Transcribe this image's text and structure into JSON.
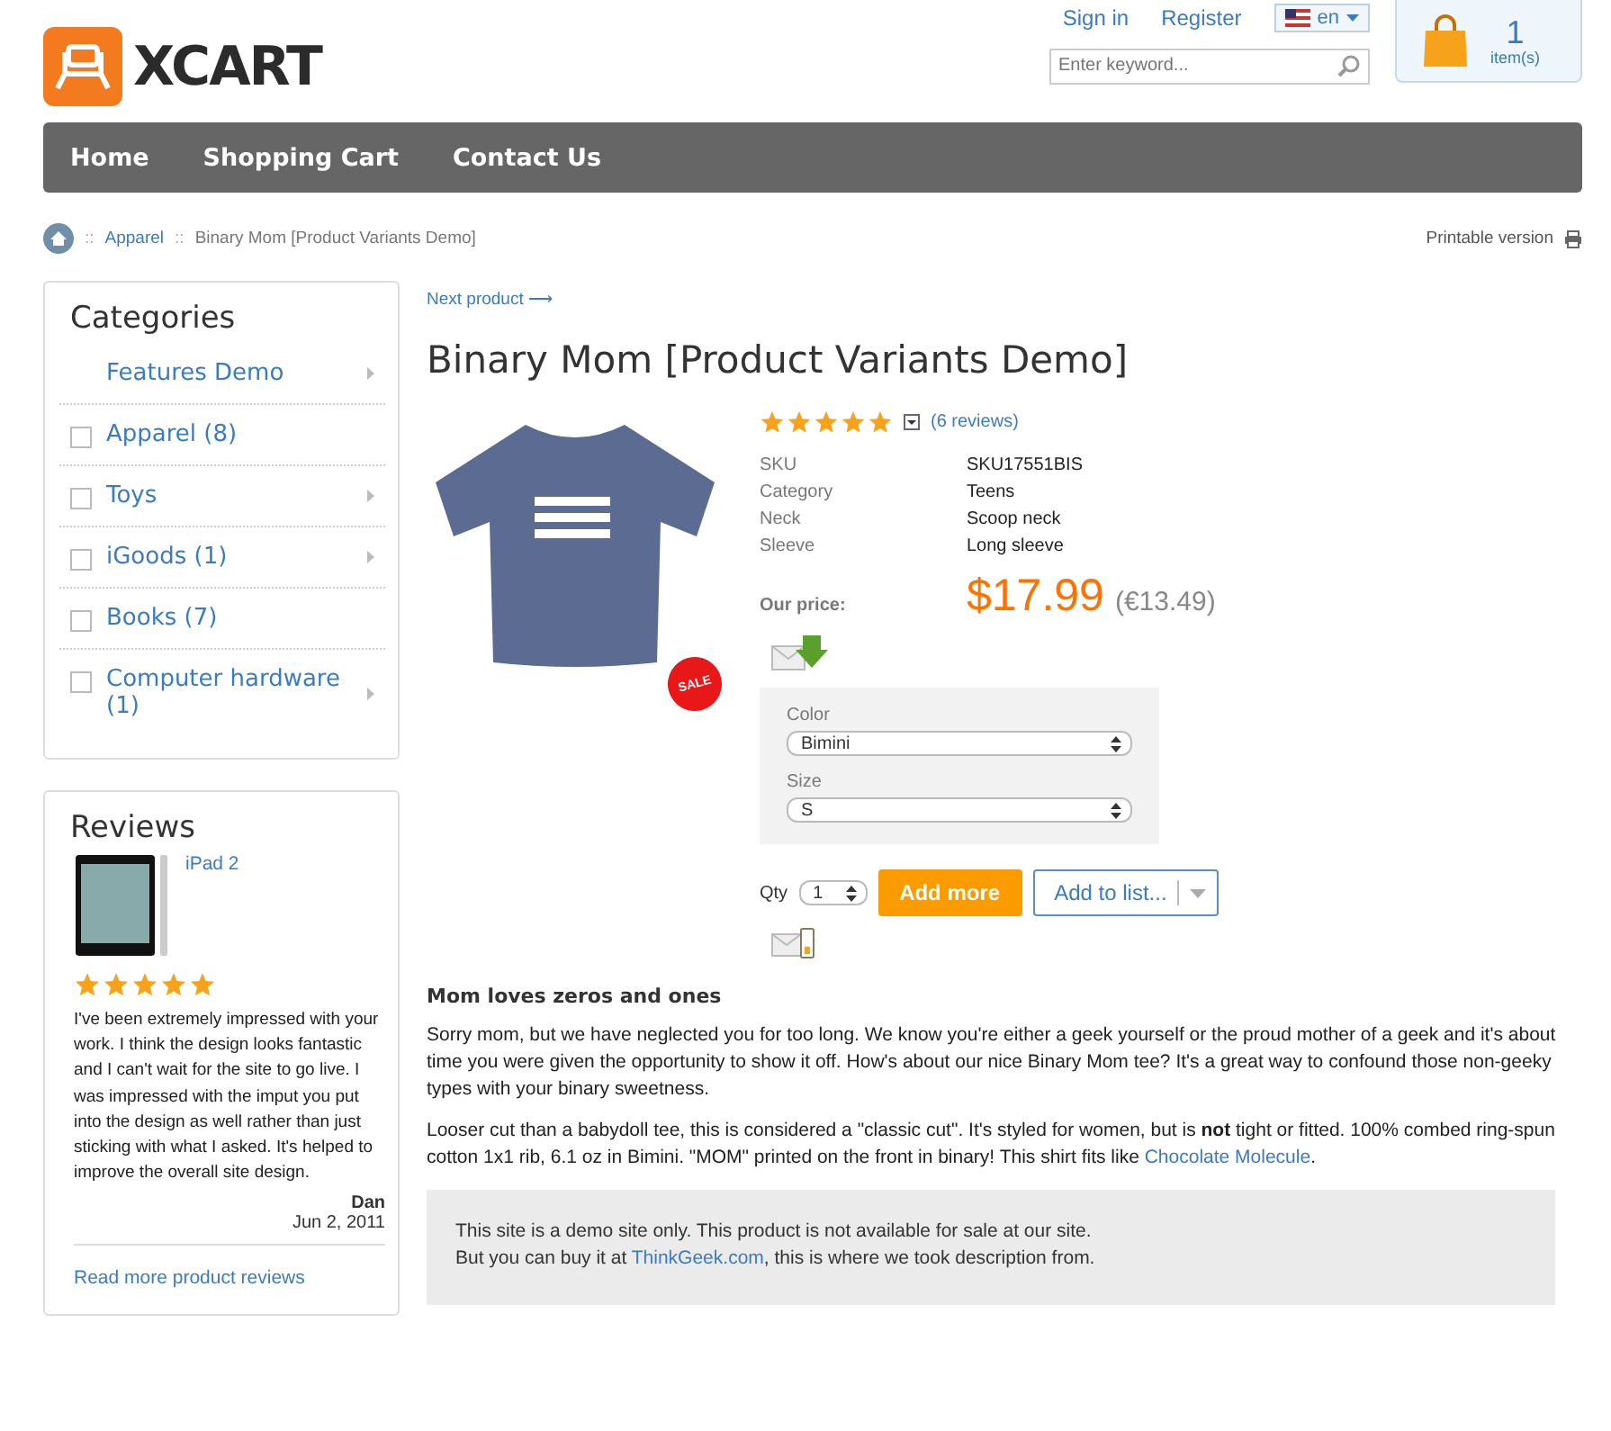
{
  "header": {
    "logo_text": "XCART",
    "sign_in": "Sign in",
    "register": "Register",
    "language": "en",
    "search": {
      "placeholder": "Enter keyword..."
    },
    "cart": {
      "count": "1",
      "label": "item(s)"
    }
  },
  "nav": [
    "Home",
    "Shopping Cart",
    "Contact Us"
  ],
  "breadcrumb": {
    "items": [
      "Apparel",
      "Binary Mom [Product Variants Demo]"
    ],
    "separator": "::",
    "printable": "Printable version"
  },
  "categories": {
    "title": "Categories",
    "items": [
      {
        "label": "Features Demo",
        "kind": "plain",
        "expandable": true
      },
      {
        "label": "Apparel (8)",
        "kind": "checkbox",
        "checked": false,
        "expandable": false
      },
      {
        "label": "Toys",
        "kind": "checkbox",
        "checked": false,
        "expandable": true
      },
      {
        "label": "iGoods (1)",
        "kind": "checkbox",
        "checked": false,
        "expandable": true
      },
      {
        "label": "Books (7)",
        "kind": "checkbox",
        "checked": false,
        "expandable": false
      },
      {
        "label": "Computer hardware (1)",
        "kind": "checkbox",
        "checked": false,
        "expandable": true
      }
    ]
  },
  "reviews": {
    "title": "Reviews",
    "product": "iPad 2",
    "stars": 5,
    "text": "I've been extremely impressed with your work. I think the design looks fantastic and I can't wait for the site to go live. I was impressed with the imput you put into the design as well rather than just sticking with what I asked. It's helped to improve the overall site design.",
    "author": "Dan",
    "date": "Jun 2, 2011",
    "more_link": "Read more product reviews"
  },
  "product": {
    "next_link": "Next product",
    "next_arrow": "⟶",
    "title": "Binary Mom [Product Variants Demo]",
    "sale_badge": "SALE",
    "stars": 5,
    "reviews_link": "(6 reviews)",
    "attributes": [
      {
        "name": "SKU",
        "value": "SKU17551BIS"
      },
      {
        "name": "Category",
        "value": "Teens"
      },
      {
        "name": "Neck",
        "value": "Scoop neck"
      },
      {
        "name": "Sleeve",
        "value": "Long sleeve"
      }
    ],
    "price_label": "Our price:",
    "price": "$17.99",
    "alt_price": "(€13.49)",
    "options": [
      {
        "label": "Color",
        "value": "Bimini"
      },
      {
        "label": "Size",
        "value": "S"
      }
    ],
    "qty_label": "Qty",
    "qty": "1",
    "add_button": "Add more",
    "list_button": "Add to list...",
    "description_title": "Mom loves zeros and ones",
    "paragraphs": [
      {
        "text": "Sorry mom, but we have neglected you for too long. We know you're either a geek yourself or the proud mother of a geek and it's about time you were given the opportunity to show it off. How's about our nice Binary Mom tee? It's a great way to confound those non-geeky types with your binary sweetness."
      },
      {
        "text": "Looser cut than a babydoll tee, this is considered a \"classic cut\". It's styled for women, but is **not** tight or fitted. 100% combed ring-spun cotton 1x1 rib, 6.1 oz in Bimini. \"MOM\" printed on the front in binary! This shirt fits like ",
        "link": "Chocolate Molecule",
        "after": "."
      }
    ],
    "note": {
      "line1": "This site is a demo site only. This product is not available for sale at our site.",
      "line2_before": "But you can buy it at ",
      "link": "ThinkGeek.com",
      "line2_after": ", this is where we took description from."
    }
  }
}
